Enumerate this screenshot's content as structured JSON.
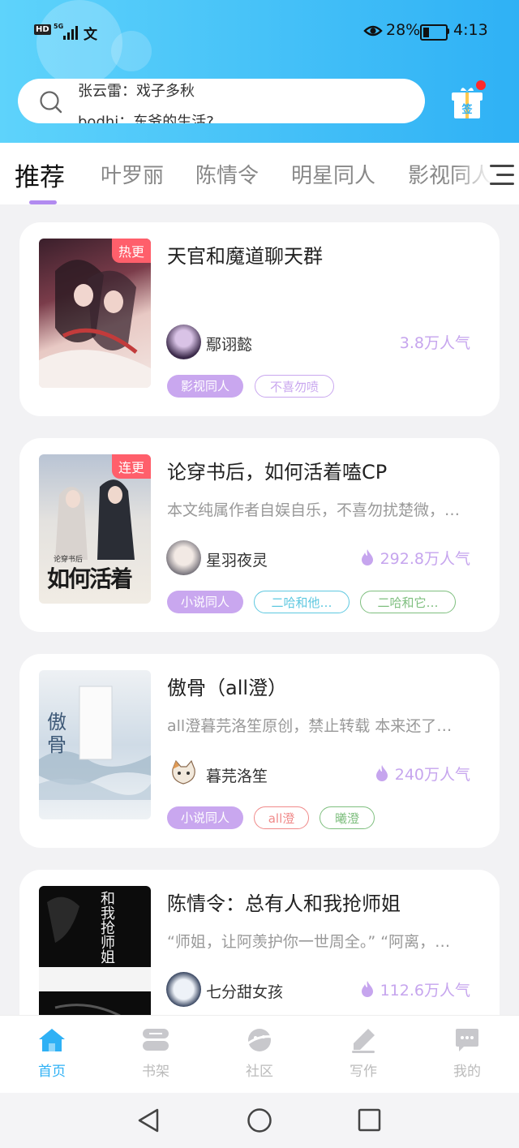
{
  "status_bar": {
    "hd_label": "HD",
    "network": "5G",
    "wifi_glyph": "文",
    "battery": "28%",
    "battery_level": 0.28,
    "time": "4:13"
  },
  "search": {
    "ticker_current": "张云雷：戏子多秋",
    "ticker_next": "bodhi：东爷的生活?",
    "icon": "search-icon"
  },
  "gift": {
    "label": "签",
    "icon": "gift-icon",
    "has_badge": true
  },
  "tabs": [
    {
      "label": "推荐",
      "active": true
    },
    {
      "label": "叶罗丽"
    },
    {
      "label": "陈情令"
    },
    {
      "label": "明星同人"
    },
    {
      "label": "影视同人"
    }
  ],
  "books": [
    {
      "title": "天官和魔道聊天群",
      "badge": "热更",
      "description": "",
      "author": "鄢诩懿",
      "popularity": "3.8万人气",
      "tags": [
        {
          "label": "影视同人",
          "style": "filled"
        },
        {
          "label": "不喜勿喷",
          "style": "outline",
          "color": "#c9a7ef"
        }
      ]
    },
    {
      "title": "论穿书后，如何活着嗑CP",
      "badge": "连更",
      "cover_text": "如何活着",
      "cover_subtitle": "论穿书后",
      "description": "本文纯属作者自娱自乐，不喜勿扰楚微，…",
      "author": "星羽夜灵",
      "popularity": "292.8万人气",
      "tags": [
        {
          "label": "小说同人",
          "style": "filled"
        },
        {
          "label": "二哈和他…",
          "style": "outline",
          "color": "#5ec8e0"
        },
        {
          "label": "二哈和它…",
          "style": "outline",
          "color": "#7fbf7f"
        }
      ]
    },
    {
      "title": "傲骨（all澄）",
      "badge": "",
      "cover_text": "傲骨",
      "description": "all澄暮芫洛笙原创，禁止转载   本来还了…",
      "author": "暮芫洛笙",
      "popularity": "240万人气",
      "tags": [
        {
          "label": "小说同人",
          "style": "filled"
        },
        {
          "label": "all澄",
          "style": "outline",
          "color": "#f08a8a"
        },
        {
          "label": "曦澄",
          "style": "outline",
          "color": "#7fbf7f"
        }
      ]
    },
    {
      "title": "陈情令：总有人和我抢师姐",
      "badge": "",
      "cover_text": "和我抢师姐",
      "description": "“师姐，让阿羡护你一世周全。” “阿离，…",
      "author": "七分甜女孩",
      "popularity": "112.6万人气",
      "tags": []
    }
  ],
  "nav": [
    {
      "label": "首页",
      "active": true,
      "icon": "home-icon"
    },
    {
      "label": "书架",
      "icon": "bookshelf-icon"
    },
    {
      "label": "社区",
      "icon": "community-icon"
    },
    {
      "label": "写作",
      "icon": "write-icon"
    },
    {
      "label": "我的",
      "icon": "profile-icon"
    }
  ],
  "system_nav": {
    "back": "back-icon",
    "home": "home-circle-icon",
    "recents": "recents-icon"
  },
  "colors": {
    "header_start": "#5ed3fb",
    "header_end": "#2fb1f5",
    "accent_purple": "#c9a7ef",
    "active_nav": "#2fb1f5",
    "badge_red": "#ff5f6b"
  }
}
